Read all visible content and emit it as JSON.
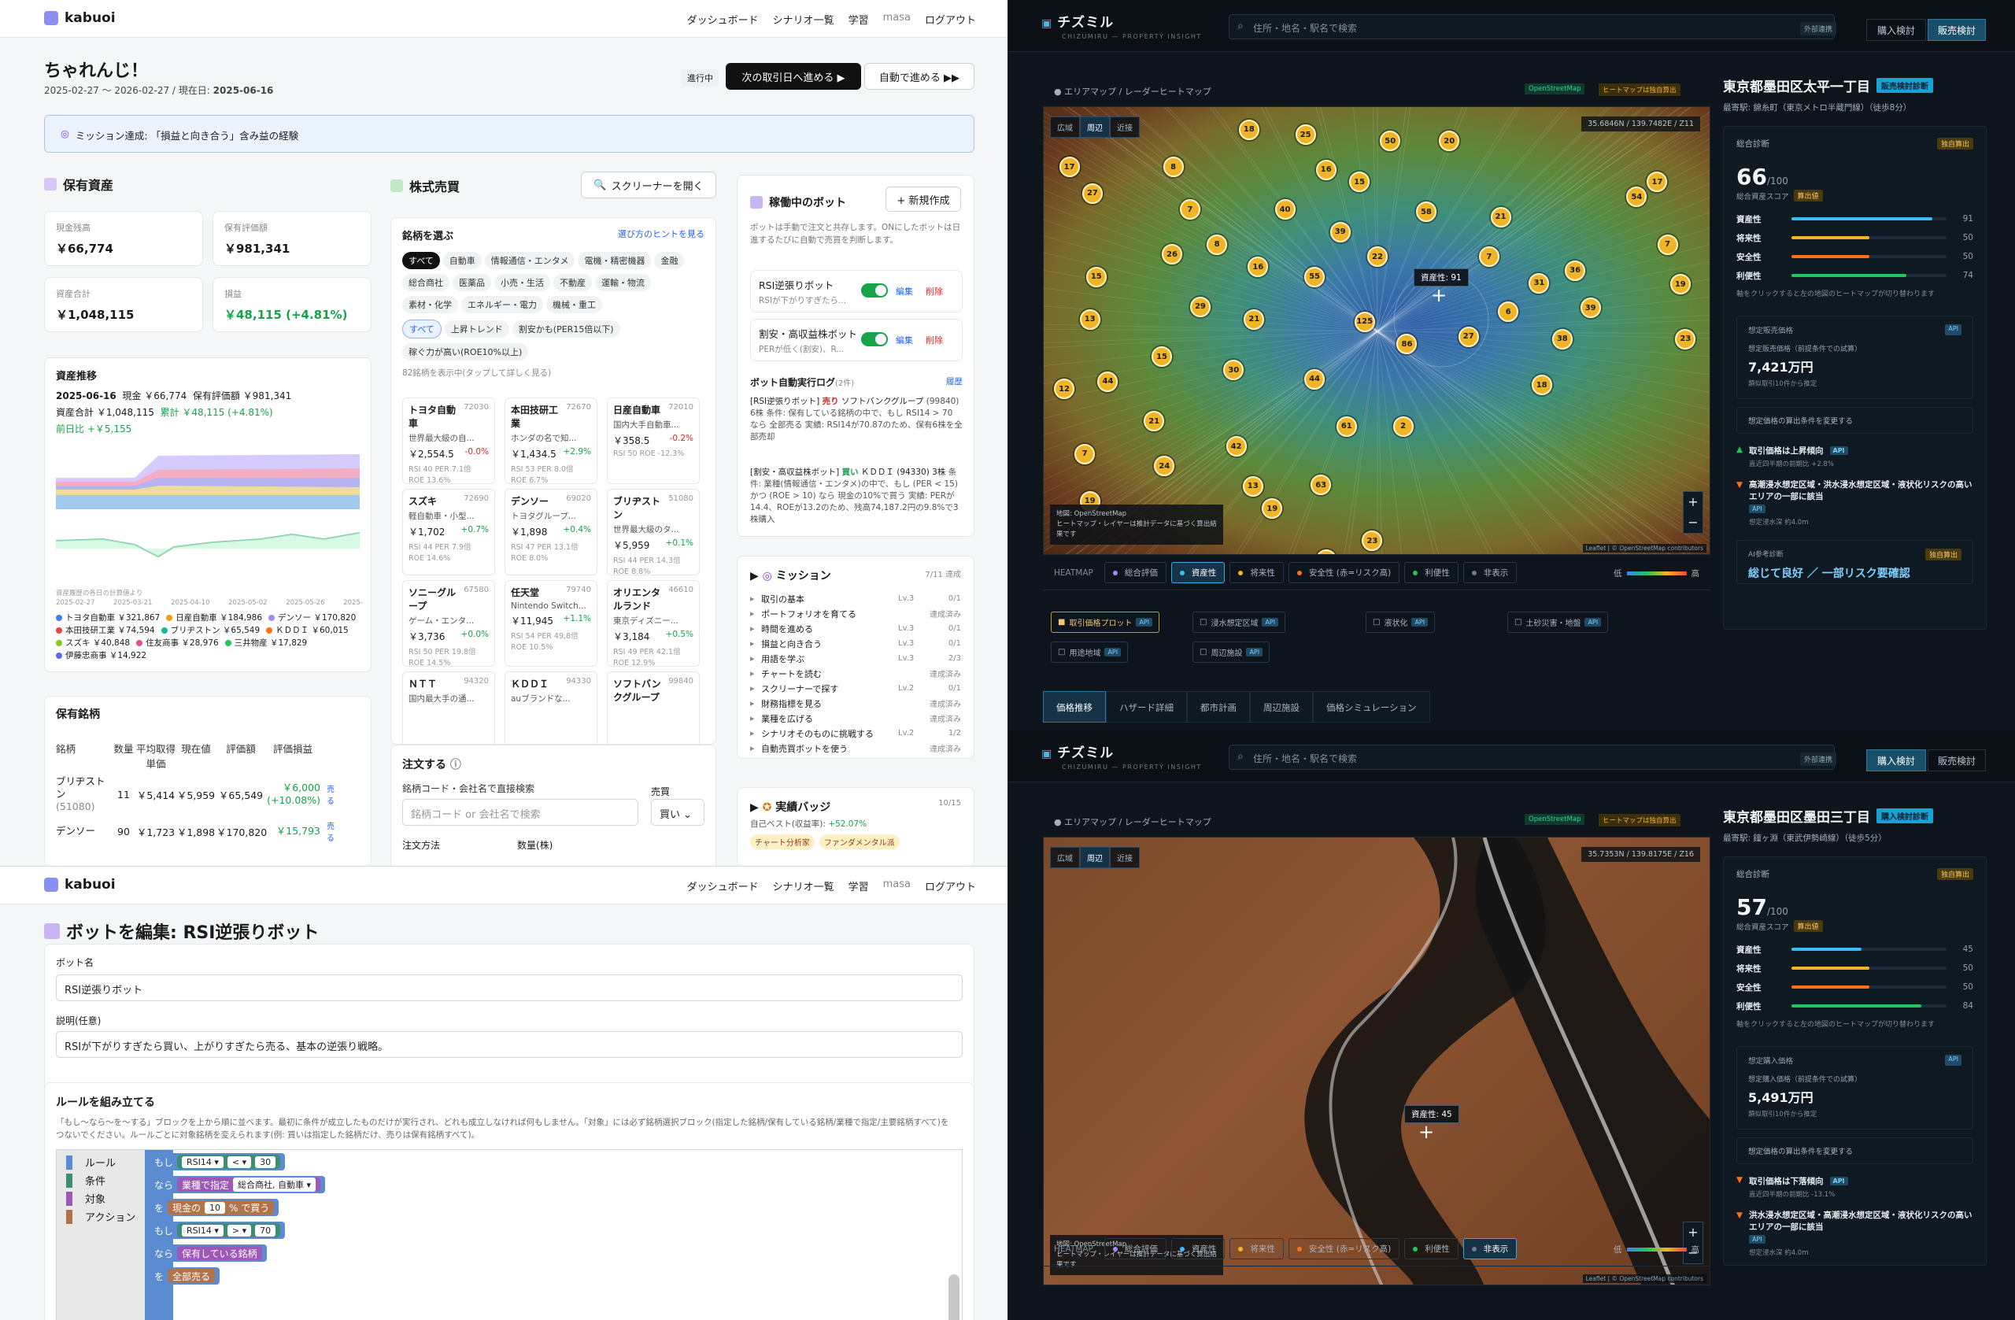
{
  "kabuoi": {
    "logo": "kabuoi",
    "nav": [
      "ダッシュボード",
      "シナリオ一覧",
      "学習",
      "masa",
      "ログアウト"
    ],
    "title": "ちゃれんじ！",
    "period": "2025-02-27 〜 2026-02-27 / 現在日: ",
    "current_date": "2025-06-16",
    "status": "進行中",
    "btn_next": "次の取引日へ進める ▶",
    "btn_auto": "自動で進める ▶▶",
    "mission_banner": "ミッション達成: 「損益と向き合う」含み益の経験",
    "assets": {
      "title": "保有資産",
      "cash_label": "現金残高",
      "cash": "￥66,774",
      "eval_label": "保有評価額",
      "eval": "￥981,341",
      "total_label": "資産合計",
      "total": "￥1,048,115",
      "pl_label": "損益",
      "pl": "￥48,115 (+4.81%)"
    },
    "history": {
      "title": "資産推移",
      "date": "2025-06-16",
      "cash": "現金 ￥66,774",
      "eval": "保有評価額 ￥981,341",
      "total": "資産合計 ￥1,048,115",
      "cum": "累計 ￥48,115 (+4.81%)",
      "dod": "前日比 +￥5,155",
      "note": "資産履歴の各日の計算値より",
      "xticks": [
        "2025-02-27",
        "2025-03-21",
        "2025-04-10",
        "2025-05-02",
        "2025-05-26",
        "2025-"
      ],
      "legend": [
        {
          "name": "トヨタ自動車 ￥321,867",
          "color": "#3b82f6"
        },
        {
          "name": "日産自動車 ￥184,986",
          "color": "#f59e0b"
        },
        {
          "name": "デンソー ￥170,820",
          "color": "#a78bfa"
        },
        {
          "name": "本田技研工業 ￥74,594",
          "color": "#ef4444"
        },
        {
          "name": "ブリヂストン ￥65,549",
          "color": "#14b8a6"
        },
        {
          "name": "ＫＤＤＩ ￥60,015",
          "color": "#f97316"
        },
        {
          "name": "スズキ ￥40,848",
          "color": "#84cc16"
        },
        {
          "name": "住友商事 ￥28,976",
          "color": "#ec4899"
        },
        {
          "name": "三井物産 ￥17,829",
          "color": "#22c55e"
        },
        {
          "name": "伊藤忠商事 ￥14,922",
          "color": "#6366f1"
        }
      ]
    },
    "holdings": {
      "title": "保有銘柄",
      "headers": [
        "銘柄",
        "数量",
        "平均取得単価",
        "現在値",
        "評価額",
        "評価損益"
      ],
      "rows": [
        {
          "name": "ブリヂストン",
          "code": "(51080)",
          "qty": "11",
          "avg": "￥5,414",
          "cur": "￥5,959",
          "val": "￥65,549",
          "pl": "￥6,000",
          "pct": "(+10.08%)",
          "act": "売る"
        },
        {
          "name": "デンソー",
          "code": "",
          "qty": "90",
          "avg": "￥1,723",
          "cur": "￥1,898",
          "val": "￥170,820",
          "pl": "￥15,793",
          "pct": "",
          "act": "売る"
        }
      ]
    },
    "trade": {
      "title": "株式売買",
      "screener": "スクリーナーを開く",
      "pick": "銘柄を選ぶ",
      "hint": "選び方のヒントを見る",
      "chips": [
        "すべて",
        "自動車",
        "情報通信・エンタメ",
        "電機・精密機器",
        "金融",
        "総合商社",
        "医薬品",
        "小売・生活",
        "不動産",
        "運輸・物流",
        "素材・化学",
        "エネルギー・電力",
        "機械・重工"
      ],
      "chips2": [
        "すべて",
        "上昇トレンド",
        "割安かも(PER15倍以下)",
        "稼ぐ力が高い(ROE10%以上)"
      ],
      "count": "82銘柄を表示中(タップして詳しく見る)",
      "stocks": [
        {
          "n": "トヨタ自動車",
          "c": "72030",
          "d": "世界最大級の自...",
          "p": "￥2,554.5",
          "ch": "-0.0%",
          "m1": "RSI 40 PER 7.1倍",
          "m2": "ROE 13.6%",
          "up": false
        },
        {
          "n": "本田技研工業",
          "c": "72670",
          "d": "ホンダの名で知...",
          "p": "￥1,434.5",
          "ch": "+2.9%",
          "m1": "RSI 53 PER 8.0倍",
          "m2": "ROE 6.7%",
          "up": true
        },
        {
          "n": "日産自動車",
          "c": "72010",
          "d": "国内大手自動車...",
          "p": "￥358.5",
          "ch": "-0.2%",
          "m1": "RSI 50 ROE -12.3%",
          "m2": "",
          "up": false
        },
        {
          "n": "スズキ",
          "c": "72690",
          "d": "軽自動車・小型...",
          "p": "￥1,702",
          "ch": "+0.7%",
          "m1": "RSI 44 PER 7.9倍",
          "m2": "ROE 14.6%",
          "up": true
        },
        {
          "n": "デンソー",
          "c": "69020",
          "d": "トヨタグループ...",
          "p": "￥1,898",
          "ch": "+0.4%",
          "m1": "RSI 47 PER 13.1倍",
          "m2": "ROE 8.0%",
          "up": true
        },
        {
          "n": "ブリヂストン",
          "c": "51080",
          "d": "世界最大級のタ...",
          "p": "￥5,959",
          "ch": "+0.1%",
          "m1": "RSI 44 PER 14.3倍",
          "m2": "ROE 8.8%",
          "up": true
        },
        {
          "n": "ソニーグループ",
          "c": "67580",
          "d": "ゲーム・エンタ...",
          "p": "￥3,736",
          "ch": "+0.0%",
          "m1": "RSI 50 PER 19.8倍",
          "m2": "ROE 14.5%",
          "up": true
        },
        {
          "n": "任天堂",
          "c": "79740",
          "d": "Nintendo Switch...",
          "p": "￥11,945",
          "ch": "+1.1%",
          "m1": "RSI 54 PER 49.8倍",
          "m2": "ROE 10.5%",
          "up": true
        },
        {
          "n": "オリエンタルランド",
          "c": "46610",
          "d": "東京ディズニー...",
          "p": "￥3,184",
          "ch": "+0.5%",
          "m1": "RSI 49 PER 42.1倍",
          "m2": "ROE 12.9%",
          "up": true
        },
        {
          "n": "ＮＴＴ",
          "c": "94320",
          "d": "国内最大手の通...",
          "p": "",
          "ch": "",
          "m1": "",
          "m2": "",
          "up": true
        },
        {
          "n": "ＫＤＤＩ",
          "c": "94330",
          "d": "auブランドな...",
          "p": "",
          "ch": "",
          "m1": "",
          "m2": "",
          "up": true
        },
        {
          "n": "ソフトバンクグループ",
          "c": "99840",
          "d": "",
          "p": "",
          "ch": "",
          "m1": "",
          "m2": "",
          "up": true
        }
      ],
      "order": "注文する",
      "order_label": "銘柄コード・会社名で直接検索",
      "order_ph": "銘柄コード or 会社名で検索",
      "side_label": "売買",
      "side_val": "買い",
      "method": "注文方法",
      "qty": "数量(株)"
    },
    "bots": {
      "title": "稼働中のボット",
      "new": "+ 新規作成",
      "desc": "ボットは手動で注文と共存します。ONにしたボットは日進するたびに自動で売買を判断します。",
      "items": [
        {
          "name": "RSI逆張りボット",
          "sub": "RSIが下がりすぎたら...",
          "edit": "編集",
          "del": "削除"
        },
        {
          "name": "割安・高収益株ボット",
          "sub": "PERが低く(割安)、R...",
          "edit": "編集",
          "del": "削除"
        }
      ],
      "log_title": "ボット自動実行ログ",
      "log_count": "(2件)",
      "log_hist": "履歴",
      "log1_head": "[RSI逆張りボット]",
      "log1_act": "売り",
      "log1_tail": "ソフトバンクグループ",
      "log1_body": "(99840) 6株 条件: 保有している銘柄の中で、もし RSI14 > 70 なら 全部売る 実績: RSI14が70.87のため、保有6株を全部売却",
      "log2_head": "[割安・高収益株ボット]",
      "log2_act": "買い",
      "log2_tail": "ＫＤＤＩ (94330) 3株",
      "log2_body": "条件: 業種(情報通信・エンタメ)の中で、もし (PER < 15) かつ (ROE > 10) なら 現金の10%で買う 実績: PERが14.4、ROEが13.2のため、残高74,187.2円の9.8%で3株購入"
    },
    "missions": {
      "title": "ミッション",
      "count": "7/11 達成",
      "items": [
        {
          "t": "取引の基本",
          "lv": "Lv.3",
          "s": "0/1"
        },
        {
          "t": "ポートフォリオを育てる",
          "lv": "",
          "s": "達成済み"
        },
        {
          "t": "時間を進める",
          "lv": "Lv.3",
          "s": "0/1"
        },
        {
          "t": "損益と向き合う",
          "lv": "Lv.3",
          "s": "0/1"
        },
        {
          "t": "用語を学ぶ",
          "lv": "Lv.3",
          "s": "2/3"
        },
        {
          "t": "チャートを読む",
          "lv": "",
          "s": "達成済み"
        },
        {
          "t": "スクリーナーで探す",
          "lv": "Lv.2",
          "s": "0/1"
        },
        {
          "t": "財務指標を見る",
          "lv": "",
          "s": "達成済み"
        },
        {
          "t": "業種を広げる",
          "lv": "",
          "s": "達成済み"
        },
        {
          "t": "シナリオそのものに挑戦する",
          "lv": "Lv.2",
          "s": "1/2"
        },
        {
          "t": "自動売買ボットを使う",
          "lv": "",
          "s": "達成済み"
        }
      ]
    },
    "badges": {
      "title": "実績バッジ",
      "count": "10/15",
      "best": "自己ベスト(収益率): ",
      "best_val": "+52.07%",
      "b1": "チャート分析家",
      "b2": "ファンダメンタル派"
    }
  },
  "editor": {
    "title": "ボットを編集: RSI逆張りボット",
    "name_label": "ボット名",
    "name": "RSI逆張りボット",
    "desc_label": "説明(任意)",
    "desc": "RSIが下がりすぎたら買い、上がりすぎたら売る、基本の逆張り戦略。",
    "rules_title": "ルールを組み立てる",
    "rules_help": "「もし〜なら〜を〜する」ブロックを上から順に並べます。最初に条件が成立したものだけが実行され、どれも成立しなければ何もしません。「対象」には必ず銘柄選択ブロック(指定した銘柄/保有している銘柄/業種で指定/主要銘柄すべて)をつないでください。ルールごとに対象銘柄を変えられます(例: 買いは指定した銘柄だけ、売りは保有銘柄すべて)。",
    "palette": [
      {
        "t": "ルール",
        "c": "#5b8bd1"
      },
      {
        "t": "条件",
        "c": "#3f8e74"
      },
      {
        "t": "対象",
        "c": "#9d58b8"
      },
      {
        "t": "アクション",
        "c": "#b0734a"
      }
    ],
    "b_if": "もし",
    "b_then": "なら",
    "b_do": "を",
    "rsi": "RSI14 ▾",
    "lt": "< ▾",
    "v30": "30",
    "gt": "> ▾",
    "v70": "70",
    "sector": "業種で指定",
    "sector_val": "総合商社, 自動車 ▾",
    "buy_pre": "現金の",
    "buy_pct": "10",
    "buy_post": "% で買う",
    "held": "保有している銘柄",
    "sell": "全部売る"
  },
  "cz": [
    {
      "brand": "チズミル",
      "sub": "CHIZUMIRU — PROPERTY INSIGHT",
      "search_ph": "住所・地名・駅名で検索",
      "ext": "外部連携",
      "tab_buy": "購入検討",
      "tab_sell": "販売検討",
      "active": "sell",
      "crumb": "● エリアマップ / レーダーヒートマップ",
      "osm": "OpenStreetMap",
      "heatcalc": "ヒートマップは独自算出",
      "zoom": [
        "広域",
        "周辺",
        "近接"
      ],
      "coord": "35.6846N / 139.7482E / Z11",
      "tooltip": "資産性: 91",
      "credit_src": "地図: OpenStreetMap",
      "credit_note": "ヒートマップ・レイヤーは推計データに基づく算出結果です",
      "leaflet": "Leaflet | © OpenStreetMap contributors",
      "heat_label": "HEATMAP",
      "heat": [
        "総合評価",
        "資産性",
        "将来性",
        "安全性 (赤=リスク高)",
        "利便性",
        "非表示"
      ],
      "heat_on": 1,
      "low": "低",
      "high": "高",
      "layers": [
        "取引価格プロット",
        "浸水想定区域",
        "液状化",
        "土砂災害・地盤",
        "用途地域",
        "周辺施設"
      ],
      "address": "東京都墨田区太平一丁目",
      "addr_tag": "販売検討診断",
      "station": "最寄駅: 錦糸町（東京メトロ半蔵門線）（徒歩8分）",
      "diag": "総合診断",
      "own": "独自算出",
      "score": "66",
      "score_den": "/100",
      "score_lbl": "総合資産スコア",
      "calc": "算出値",
      "metrics": [
        {
          "k": "資産性",
          "v": "91",
          "c": "#38bdf8"
        },
        {
          "k": "将来性",
          "v": "50",
          "c": "#f0b429"
        },
        {
          "k": "安全性",
          "v": "50",
          "c": "#f97316"
        },
        {
          "k": "利便性",
          "v": "74",
          "c": "#22c55e"
        }
      ],
      "metric_note": "軸をクリックすると左の地図のヒートマップが切り替わります",
      "est_title": "想定販売価格",
      "api": "API",
      "est_sub": "想定販売価格（前提条件での試算）",
      "est": "7,421万円",
      "est_note": "類似取引10件から推定",
      "cond": "想定価格の算出条件を変更する",
      "f1": "取引価格は上昇傾向",
      "f1_sub": "直近四半期の前期比 +2.8%",
      "f2": "高潮浸水想定区域・洪水浸水想定区域・液状化リスクの高いエリアの一部に該当",
      "f2_sub": "想定浸水深 約4.0m",
      "ai_lbl": "AI参考診断",
      "ai": "総じて良好 ／ 一部リスク要確認",
      "subtabs": [
        "価格推移",
        "ハザード詳細",
        "都市計画",
        "周辺施設",
        "価格シミュレーション"
      ],
      "pins": [
        [
          "18",
          152,
          10
        ],
        [
          "25",
          196,
          14
        ],
        [
          "50",
          262,
          19
        ],
        [
          "20",
          308,
          19
        ],
        [
          "17",
          12,
          40
        ],
        [
          "8",
          93,
          40
        ],
        [
          "16",
          212,
          42
        ],
        [
          "15",
          238,
          52
        ],
        [
          "27",
          30,
          61
        ],
        [
          "7",
          106,
          74
        ],
        [
          "40",
          180,
          74
        ],
        [
          "58",
          290,
          76
        ],
        [
          "21",
          348,
          80
        ],
        [
          "39",
          223,
          92
        ],
        [
          "8",
          127,
          102
        ],
        [
          "26",
          92,
          110
        ],
        [
          "22",
          252,
          112
        ],
        [
          "7",
          339,
          112
        ],
        [
          "16",
          159,
          120
        ],
        [
          "55",
          203,
          128
        ],
        [
          "15",
          33,
          128
        ],
        [
          "31",
          378,
          133
        ],
        [
          "36",
          406,
          123
        ],
        [
          "54",
          454,
          64
        ],
        [
          "17",
          470,
          52
        ],
        [
          "7",
          478,
          102
        ],
        [
          "19",
          488,
          134
        ],
        [
          "29",
          114,
          152
        ],
        [
          "21",
          156,
          162
        ],
        [
          "125",
          242,
          164
        ],
        [
          "6",
          354,
          156
        ],
        [
          "39",
          418,
          153
        ],
        [
          "13",
          28,
          162
        ],
        [
          "86",
          275,
          182
        ],
        [
          "27",
          323,
          176
        ],
        [
          "38",
          396,
          178
        ],
        [
          "23",
          492,
          178
        ],
        [
          "15",
          84,
          192
        ],
        [
          "30",
          140,
          203
        ],
        [
          "44",
          203,
          210
        ],
        [
          "18",
          380,
          215
        ],
        [
          "12",
          8,
          218
        ],
        [
          "44",
          42,
          212
        ],
        [
          "21",
          78,
          244
        ],
        [
          "61",
          228,
          248
        ],
        [
          "2",
          272,
          248
        ],
        [
          "42",
          142,
          264
        ],
        [
          "7",
          24,
          270
        ],
        [
          "24",
          86,
          280
        ],
        [
          "13",
          155,
          296
        ],
        [
          "63",
          208,
          295
        ],
        [
          "19",
          28,
          308
        ],
        [
          "19",
          170,
          314
        ],
        [
          "23",
          248,
          340
        ],
        [
          "84",
          212,
          355
        ]
      ]
    },
    {
      "brand": "チズミル",
      "sub": "CHIZUMIRU — PROPERTY INSIGHT",
      "search_ph": "住所・地名・駅名で検索",
      "ext": "外部連携",
      "tab_buy": "購入検討",
      "tab_sell": "販売検討",
      "active": "buy",
      "crumb": "● エリアマップ / レーダーヒートマップ",
      "osm": "OpenStreetMap",
      "heatcalc": "ヒートマップは独自算出",
      "zoom": [
        "広域",
        "周辺",
        "近接"
      ],
      "coord": "35.7353N / 139.8175E / Z16",
      "tooltip": "資産性: 45",
      "credit_src": "地図: OpenStreetMap",
      "credit_note": "ヒートマップ・レイヤーは推計データに基づく算出結果です",
      "leaflet": "Leaflet | © OpenStreetMap contributors",
      "heat_label": "HEATMAP",
      "heat": [
        "総合評価",
        "資産性",
        "将来性",
        "安全性 (赤=リスク高)",
        "利便性",
        "非表示"
      ],
      "heat_on": 5,
      "low": "低",
      "high": "高",
      "layers": [],
      "address": "東京都墨田区墨田三丁目",
      "addr_tag": "購入検討診断",
      "station": "最寄駅: 鐘ヶ淵（東武伊勢崎線）（徒歩5分）",
      "diag": "総合診断",
      "own": "独自算出",
      "score": "57",
      "score_den": "/100",
      "score_lbl": "総合資産スコア",
      "calc": "算出値",
      "metrics": [
        {
          "k": "資産性",
          "v": "45",
          "c": "#38bdf8"
        },
        {
          "k": "将来性",
          "v": "50",
          "c": "#f0b429"
        },
        {
          "k": "安全性",
          "v": "50",
          "c": "#f97316"
        },
        {
          "k": "利便性",
          "v": "84",
          "c": "#22c55e"
        }
      ],
      "metric_note": "軸をクリックすると左の地図のヒートマップが切り替わります",
      "est_title": "想定購入価格",
      "api": "API",
      "est_sub": "想定購入価格（前提条件での試算）",
      "est": "5,491万円",
      "est_note": "類似取引10件から推定",
      "cond": "想定価格の算出条件を変更する",
      "f1": "取引価格は下落傾向",
      "f1_sub": "直近四半期の前期比 -13.1%",
      "f2": "洪水浸水想定区域・高潮浸水想定区域・液状化リスクの高いエリアの一部に該当",
      "f2_sub": "想定浸水深 約4.0m",
      "ai_lbl": "",
      "ai": "",
      "subtabs": [],
      "pins": []
    }
  ]
}
